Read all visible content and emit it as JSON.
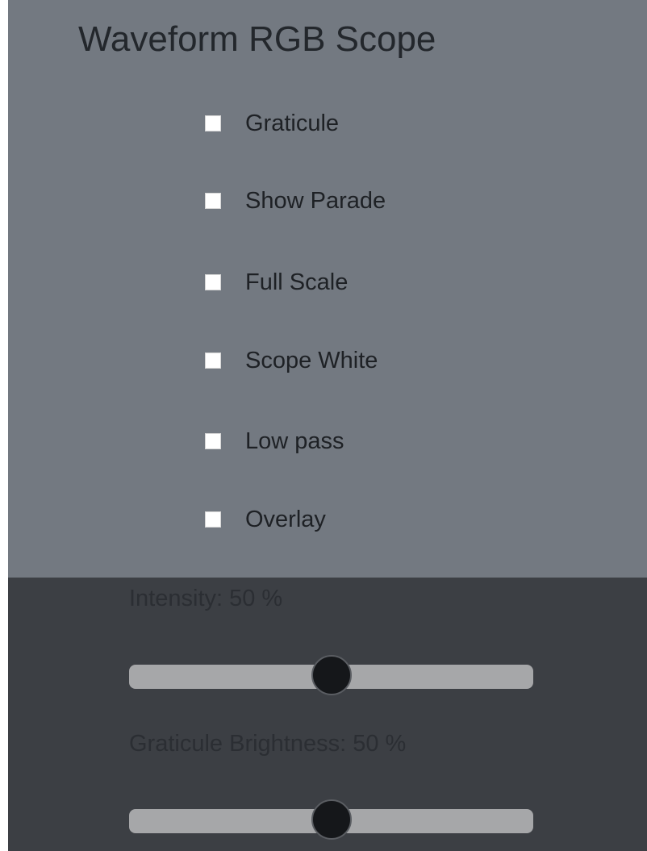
{
  "title": "Waveform RGB Scope",
  "options": [
    {
      "label": "Graticule",
      "checked": false
    },
    {
      "label": "Show Parade",
      "checked": false
    },
    {
      "label": "Full Scale",
      "checked": false
    },
    {
      "label": "Scope White",
      "checked": false
    },
    {
      "label": "Low pass",
      "checked": false
    },
    {
      "label": "Overlay",
      "checked": false
    }
  ],
  "sliders": [
    {
      "label": "Intensity: 50 %",
      "value": 50,
      "min": 0,
      "max": 100
    },
    {
      "label": "Graticule Brightness: 50 %",
      "value": 50,
      "min": 0,
      "max": 100
    }
  ],
  "colors": {
    "top_background": "#737981",
    "bottom_background": "#3c3f44",
    "checkbox": "#ffffff",
    "slider_track": "#a6a7a9",
    "slider_thumb": "#15171a"
  }
}
